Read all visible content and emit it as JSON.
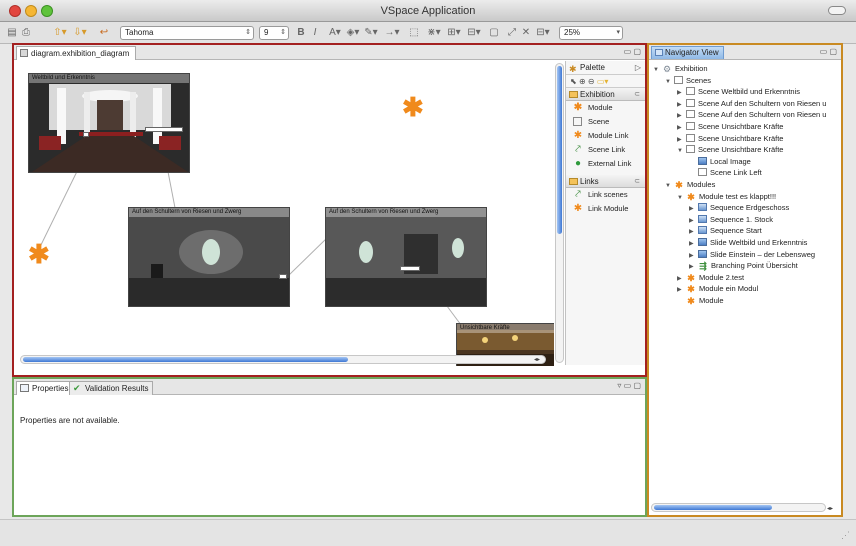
{
  "window": {
    "title": "VSpace Application"
  },
  "toolbar": {
    "font_name": "Tahoma",
    "font_size": "9",
    "bold_label": "B",
    "italic_label": "I",
    "zoom": "25%"
  },
  "editor": {
    "tab_label": "diagram.exhibition_diagram",
    "scenes": [
      {
        "title": "Weltbild und Erkenntnis"
      },
      {
        "title": "Auf den Schultern von Riesen und Zwerg"
      },
      {
        "title": "Auf den Schultern von Riesen und Zwerg"
      },
      {
        "title": "Unsichtbare Kräfte"
      }
    ]
  },
  "palette": {
    "title": "Palette",
    "drawers": [
      {
        "label": "Exhibition",
        "items": [
          {
            "label": "Module",
            "icon": "module-icon"
          },
          {
            "label": "Scene",
            "icon": "scene-icon"
          },
          {
            "label": "Module Link",
            "icon": "module-link-icon"
          },
          {
            "label": "Scene Link",
            "icon": "scene-link-icon"
          },
          {
            "label": "External Link",
            "icon": "external-link-icon"
          }
        ]
      },
      {
        "label": "Links",
        "items": [
          {
            "label": "Link scenes",
            "icon": "link-scenes-icon"
          },
          {
            "label": "Link Module",
            "icon": "link-module-icon"
          }
        ]
      }
    ]
  },
  "navigator": {
    "tab_label": "Navigator View",
    "tree": [
      {
        "label": "Exhibition",
        "level": 0,
        "twisty": "open",
        "icon": "gear"
      },
      {
        "label": "Scenes",
        "level": 1,
        "twisty": "open",
        "icon": "page"
      },
      {
        "label": "Scene Weltbild und Erkenntnis",
        "level": 2,
        "twisty": "closed",
        "icon": "page"
      },
      {
        "label": "Scene Auf den Schultern von Riesen u",
        "level": 2,
        "twisty": "closed",
        "icon": "page"
      },
      {
        "label": "Scene Auf den Schultern von Riesen u",
        "level": 2,
        "twisty": "closed",
        "icon": "page"
      },
      {
        "label": "Scene Unsichtbare Kräfte",
        "level": 2,
        "twisty": "closed",
        "icon": "page"
      },
      {
        "label": "Scene Unsichtbare Kräfte",
        "level": 2,
        "twisty": "closed",
        "icon": "page"
      },
      {
        "label": "Scene Unsichtbare Kräfte",
        "level": 2,
        "twisty": "open",
        "icon": "page"
      },
      {
        "label": "Local Image",
        "level": 3,
        "twisty": "none",
        "icon": "img"
      },
      {
        "label": "Scene Link Left",
        "level": 3,
        "twisty": "none",
        "icon": "page"
      },
      {
        "label": "Modules",
        "level": 1,
        "twisty": "open",
        "icon": "star"
      },
      {
        "label": "Module test es klappt!!!",
        "level": 2,
        "twisty": "open",
        "icon": "star"
      },
      {
        "label": "Sequence Erdgeschoss",
        "level": 3,
        "twisty": "closed",
        "icon": "seq"
      },
      {
        "label": "Sequence 1. Stock",
        "level": 3,
        "twisty": "closed",
        "icon": "seq"
      },
      {
        "label": "Sequence Start",
        "level": 3,
        "twisty": "closed",
        "icon": "seq"
      },
      {
        "label": "Slide Weltbild und Erkenntnis",
        "level": 3,
        "twisty": "closed",
        "icon": "img"
      },
      {
        "label": "Slide Einstein – der Lebensweg",
        "level": 3,
        "twisty": "closed",
        "icon": "img"
      },
      {
        "label": "Branching Point Übersicht",
        "level": 3,
        "twisty": "closed",
        "icon": "branch"
      },
      {
        "label": "Module 2.test",
        "level": 2,
        "twisty": "closed",
        "icon": "star"
      },
      {
        "label": "Module ein Modul",
        "level": 2,
        "twisty": "closed",
        "icon": "star"
      },
      {
        "label": "Module",
        "level": 2,
        "twisty": "none",
        "icon": "star"
      }
    ]
  },
  "properties": {
    "tab_properties": "Properties",
    "tab_validation": "Validation Results",
    "message": "Properties are not available."
  },
  "colors": {
    "editor_border": "#a32020",
    "navigator_border": "#c98a22",
    "properties_border": "#6da55a",
    "module_orange": "#f08a1c"
  }
}
